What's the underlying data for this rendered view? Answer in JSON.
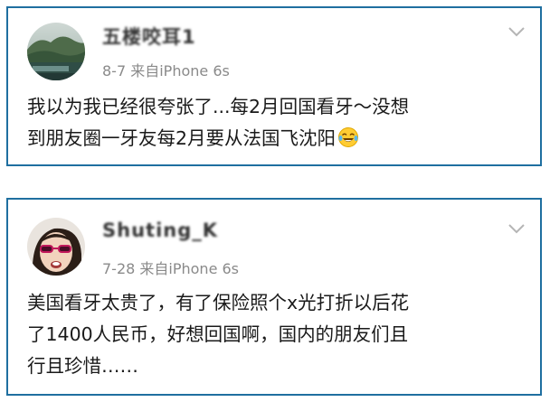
{
  "posts": [
    {
      "username": "五楼咬耳1",
      "meta": "8-7  来自iPhone 6s",
      "lines": [
        "我以为我已经很夸张了...每2月回国看牙～没想",
        "到朋友圈一牙友每2月要从法国飞沈阳"
      ],
      "emoji": "laughing-tears-emoji"
    },
    {
      "username": "Shuting_K",
      "meta": "7-28  来自iPhone 6s",
      "lines": [
        "美国看牙太贵了，有了保险照个x光打折以后花",
        "了1400人民币，好想回国啊，国内的朋友们且",
        "行且珍惜……"
      ]
    }
  ],
  "colors": {
    "card_border": "#1f6fa0",
    "meta_text": "#8a8a8a",
    "body_text": "#1a1a1a"
  },
  "icons": {
    "more": "chevron-down-icon"
  }
}
